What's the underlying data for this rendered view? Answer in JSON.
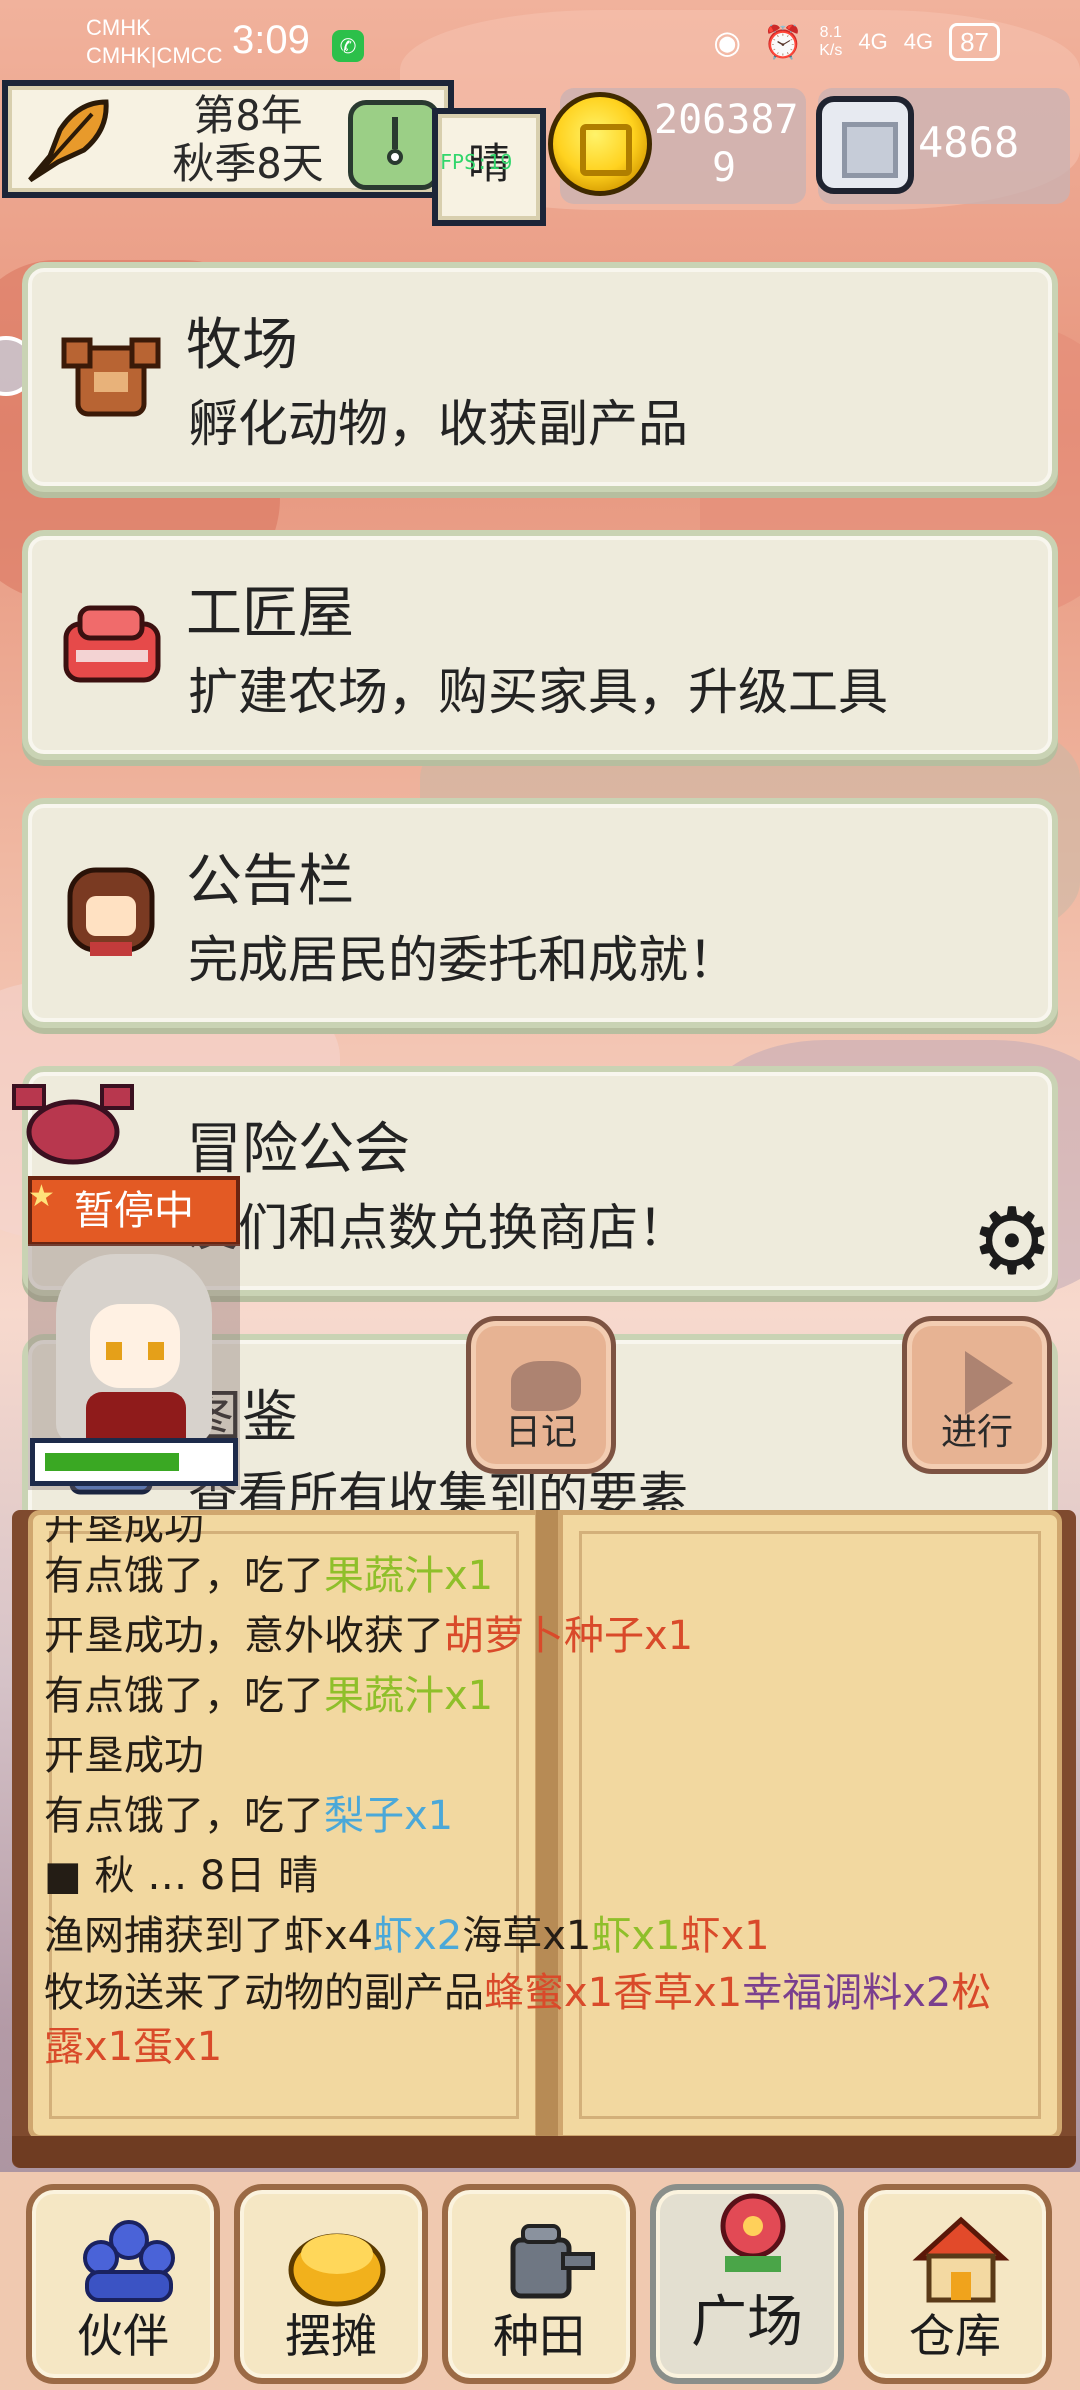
{
  "status_bar": {
    "carrier_1": "CMHK",
    "carrier_2": "CMHK|CMCC",
    "time": "3:09",
    "net_speed_value": "8.1",
    "net_speed_unit": "K/s",
    "signal_1": "4G",
    "signal_2": "4G",
    "battery": "87"
  },
  "hud": {
    "year": "第8年",
    "season_day": "秋季8天",
    "weather": "晴",
    "fps": "FPS:19",
    "gold": "2063879",
    "gold_line1": "206387",
    "gold_line2": "9",
    "gems": "4868"
  },
  "menu": [
    {
      "title": "牧场",
      "desc": "孵化动物，收获副产品",
      "icon": "ranch-icon"
    },
    {
      "title": "工匠屋",
      "desc": "扩建农场，购买家具，升级工具",
      "icon": "workshop-icon"
    },
    {
      "title": "公告栏",
      "desc": "完成居民的委托和成就！",
      "icon": "bulletin-icon"
    },
    {
      "title": "冒险公会",
      "desc": "友们和点数兑换商店！",
      "icon": "guild-icon"
    },
    {
      "title": "图鉴",
      "desc": "查看所有收集到的要素",
      "icon": "encyclopedia-icon"
    }
  ],
  "overlay": {
    "pause_label": "暂停中",
    "hp_fraction": 0.75,
    "diary_label": "日记",
    "go_label": "进行"
  },
  "log": {
    "line0": "开垦成功",
    "line1_text": "有点饿了，吃了",
    "line1_item": "果蔬汁x1",
    "line2_text": "开垦成功，意外收获了",
    "line2_item": "胡萝卜种子x1",
    "line3_text": "有点饿了，吃了",
    "line3_item": "果蔬汁x1",
    "line4": "开垦成功",
    "line5_text": "有点饿了，吃了",
    "line5_item": "梨子x1",
    "line6": "■ 秋 … 8日 晴",
    "line7_text": "渔网捕获到了虾x4",
    "line7_a": "虾x2",
    "line7_b": "海草x1",
    "line7_c": "虾x1",
    "line7_d": "虾x1",
    "line8_text": "牧场送来了动物的副产品",
    "line8_a": "蜂蜜x1",
    "line8_b": "香草x1",
    "line8_c": "幸福调料x2",
    "line8_d": "松露x1",
    "line8_e": "蛋x1",
    "colors": {
      "green": "#8fbf2a",
      "red": "#d94a2a",
      "blue": "#4ba8d8",
      "purple": "#7a3f8e",
      "dark": "#241d15"
    }
  },
  "nav": [
    {
      "label": "伙伴",
      "icon": "partners-icon"
    },
    {
      "label": "摆摊",
      "icon": "stall-icon"
    },
    {
      "label": "种田",
      "icon": "farming-icon"
    },
    {
      "label": "广场",
      "icon": "plaza-icon",
      "active": true
    },
    {
      "label": "仓库",
      "icon": "warehouse-icon"
    }
  ]
}
